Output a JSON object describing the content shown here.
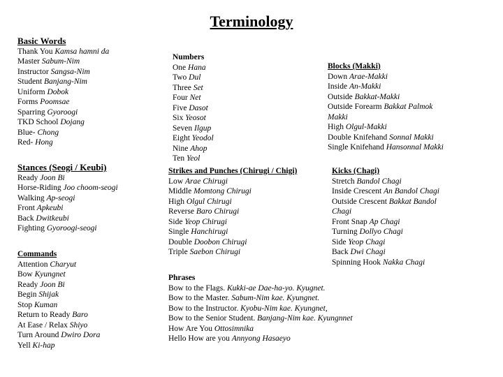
{
  "title": "Terminology",
  "basic_words": {
    "heading": "Basic Words",
    "items": [
      {
        "en": "Thank You",
        "ko": "Kamsa hamni da"
      },
      {
        "en": "Master",
        "ko": "Sabum-Nim"
      },
      {
        "en": "Instructor",
        "ko": "Sangsa-Nim"
      },
      {
        "en": "Student",
        "ko": "Banjang-Nim"
      },
      {
        "en": "Uniform",
        "ko": "Dobok"
      },
      {
        "en": "Forms",
        "ko": "Poomsae"
      },
      {
        "en": "Sparring",
        "ko": "Gyoroogi"
      },
      {
        "en": "TKD School",
        "ko": "Dojang"
      },
      {
        "en": "Blue-",
        "ko": "Chong"
      },
      {
        "en": "Red-",
        "ko": "Hong"
      }
    ]
  },
  "stances": {
    "heading": "Stances (Seogi / Keubi)",
    "items": [
      {
        "en": "Ready",
        "ko": "Joon Bi"
      },
      {
        "en": "Horse-Riding",
        "ko": "Joo choom-seogi"
      },
      {
        "en": "Walking",
        "ko": "Ap-seogi"
      },
      {
        "en": "Front",
        "ko": "Apkeubi"
      },
      {
        "en": "Back",
        "ko": "Dwitkeubi"
      },
      {
        "en": "Fighting",
        "ko": "Gyoroogi-seogi"
      }
    ]
  },
  "commands": {
    "heading": "Commands",
    "items": [
      {
        "en": "Attention",
        "ko": "Charyut"
      },
      {
        "en": "Bow",
        "ko": "Kyungnet"
      },
      {
        "en": "Ready",
        "ko": "Joon Bi"
      },
      {
        "en": "Begin",
        "ko": "Shijak"
      },
      {
        "en": "Stop",
        "ko": "Kuman"
      },
      {
        "en": "Return to Ready",
        "ko": "Baro"
      },
      {
        "en": "At Ease / Relax",
        "ko": "Shiyo"
      },
      {
        "en": "Turn Around",
        "ko": "Dwiro Dora"
      },
      {
        "en": "Yell",
        "ko": "Ki-hap"
      }
    ]
  },
  "numbers": {
    "heading": "Numbers",
    "items": [
      {
        "en": "One",
        "ko": "Hana"
      },
      {
        "en": "Two",
        "ko": "Dul"
      },
      {
        "en": "Three",
        "ko": "Set"
      },
      {
        "en": "Four",
        "ko": "Net"
      },
      {
        "en": "Five",
        "ko": "Dasot"
      },
      {
        "en": "Six",
        "ko": "Yeosot"
      },
      {
        "en": "Seven",
        "ko": "Ilgup"
      },
      {
        "en": "Eight",
        "ko": "Yeodol"
      },
      {
        "en": "Nine",
        "ko": "Ahop"
      },
      {
        "en": "Ten",
        "ko": "Yeol"
      }
    ]
  },
  "blocks": {
    "heading": "Blocks (Makki)",
    "items": [
      {
        "en": "Down",
        "ko": "Araе-Makki"
      },
      {
        "en": "Inside",
        "ko": "An-Makki"
      },
      {
        "en": "Outside",
        "ko": "Bakkat-Makki"
      },
      {
        "en": "Outside Forearm",
        "ko": "Bakkat Palmok"
      },
      {
        "en": "",
        "ko": "Makki"
      },
      {
        "en": "High",
        "ko": "Olgul-Makki"
      },
      {
        "en": "Double Knifehand",
        "ko": "Sonnal Makki"
      },
      {
        "en": "Single Knifehand",
        "ko": "Hansonnal Makki"
      }
    ]
  },
  "strikes": {
    "heading": "Strikes and Punches (Chirugi / Chigi)",
    "items": [
      {
        "en": "Low",
        "ko": "Arae Chirugi"
      },
      {
        "en": "Middle",
        "ko": "Momtong Chirugi"
      },
      {
        "en": "High",
        "ko": "Olgul Chirugi"
      },
      {
        "en": "Reverse",
        "ko": "Baro Chirugi"
      },
      {
        "en": "Side",
        "ko": "Yeop Chirugi"
      },
      {
        "en": "Single",
        "ko": "Hanchirugi"
      },
      {
        "en": "Double",
        "ko": "Doobon Chirugi"
      },
      {
        "en": "Triple",
        "ko": "Saebon Chirugi"
      }
    ]
  },
  "kicks": {
    "heading": "Kicks (Chagi)",
    "items": [
      {
        "en": "Stretch",
        "ko": "Bandol Chagi"
      },
      {
        "en": "Inside Crescent",
        "ko": "An Bandol Chagi"
      },
      {
        "en": "Outside Crescent",
        "ko": "Bakkat Bandol"
      },
      {
        "en": "",
        "ko": "Chagi"
      },
      {
        "en": "Front Snap",
        "ko": "Ap Chagi"
      },
      {
        "en": "Turning",
        "ko": "Dollyo Chagi"
      },
      {
        "en": "Side",
        "ko": "Yeop Chagi"
      },
      {
        "en": "Back",
        "ko": "Dwi Chagi"
      },
      {
        "en": "Spinning Hook",
        "ko": "Nakka Chagi"
      }
    ]
  },
  "phrases": {
    "heading": "Phrases",
    "items": [
      {
        "en": "Bow to the Flags.",
        "ko": "Kukki-ae Dae-ha-yo. Kyugnet."
      },
      {
        "en": "Bow to the Master.",
        "ko": "Sabum-Nim kae. Kyungnet."
      },
      {
        "en": "Bow to the Instructor.",
        "ko": "Kyobu-Nim kae. Kyungnet,"
      },
      {
        "en": "Bow to the Senior Student.",
        "ko": "Banjang-Nim kae. Kyungnnet"
      },
      {
        "en": "How Are You",
        "ko": "Ottosimnika"
      },
      {
        "en": "Hello How are you ",
        "ko": "Annyong Hasaeyo"
      }
    ]
  }
}
